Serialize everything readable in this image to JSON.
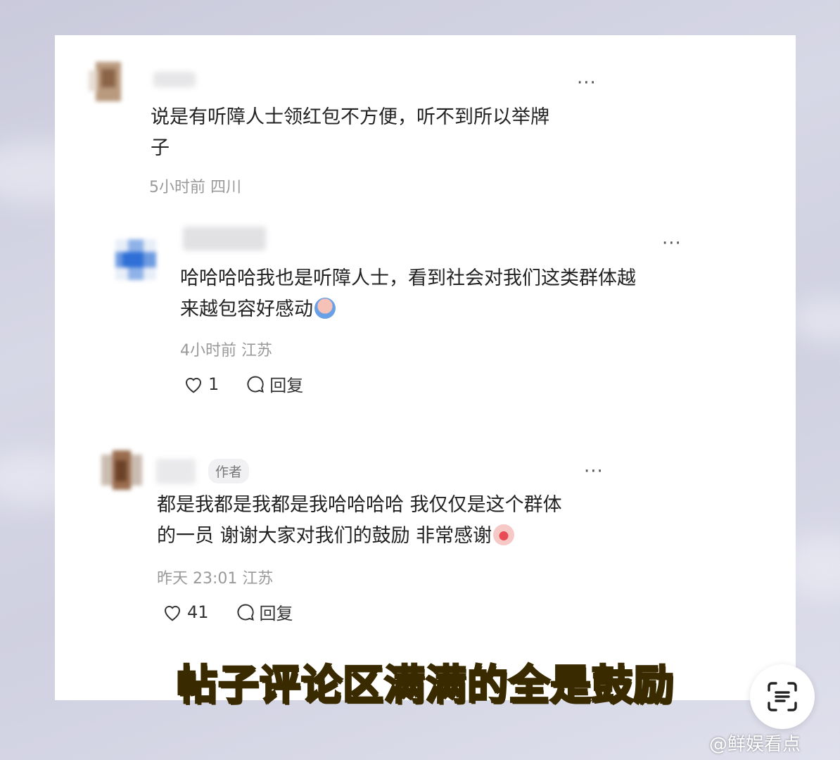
{
  "comments": [
    {
      "text": "说是有听障人士领红包不方便，听不到所以举牌子",
      "line1": "说是有听障人士领红包不方便，听不到所以举牌",
      "line2": "子",
      "meta": "5小时前 四川"
    },
    {
      "line1": "哈哈哈哈我也是听障人士，看到社会对我们这类群体越",
      "line2": "来越包容好感动",
      "meta": "4小时前 江苏",
      "likes": "1",
      "reply_label": "回复"
    },
    {
      "author_tag": "作者",
      "line1": "都是我都是我都是我哈哈哈哈 我仅仅是这个群体",
      "line2": "的一员 谢谢大家对我们的鼓励 非常感谢",
      "meta": "昨天 23:01 江苏",
      "likes": "41",
      "reply_label": "回复"
    }
  ],
  "more_label": "···",
  "caption": "帖子评论区满满的全是鼓励",
  "watermark": "@鲜娱看点",
  "icons": [
    "more-icon",
    "heart-icon",
    "comment-icon",
    "scan-text-icon",
    "emoji-icon"
  ],
  "colors": {
    "caption": "#ffd21a",
    "meta": "#999999",
    "text": "#222222"
  }
}
